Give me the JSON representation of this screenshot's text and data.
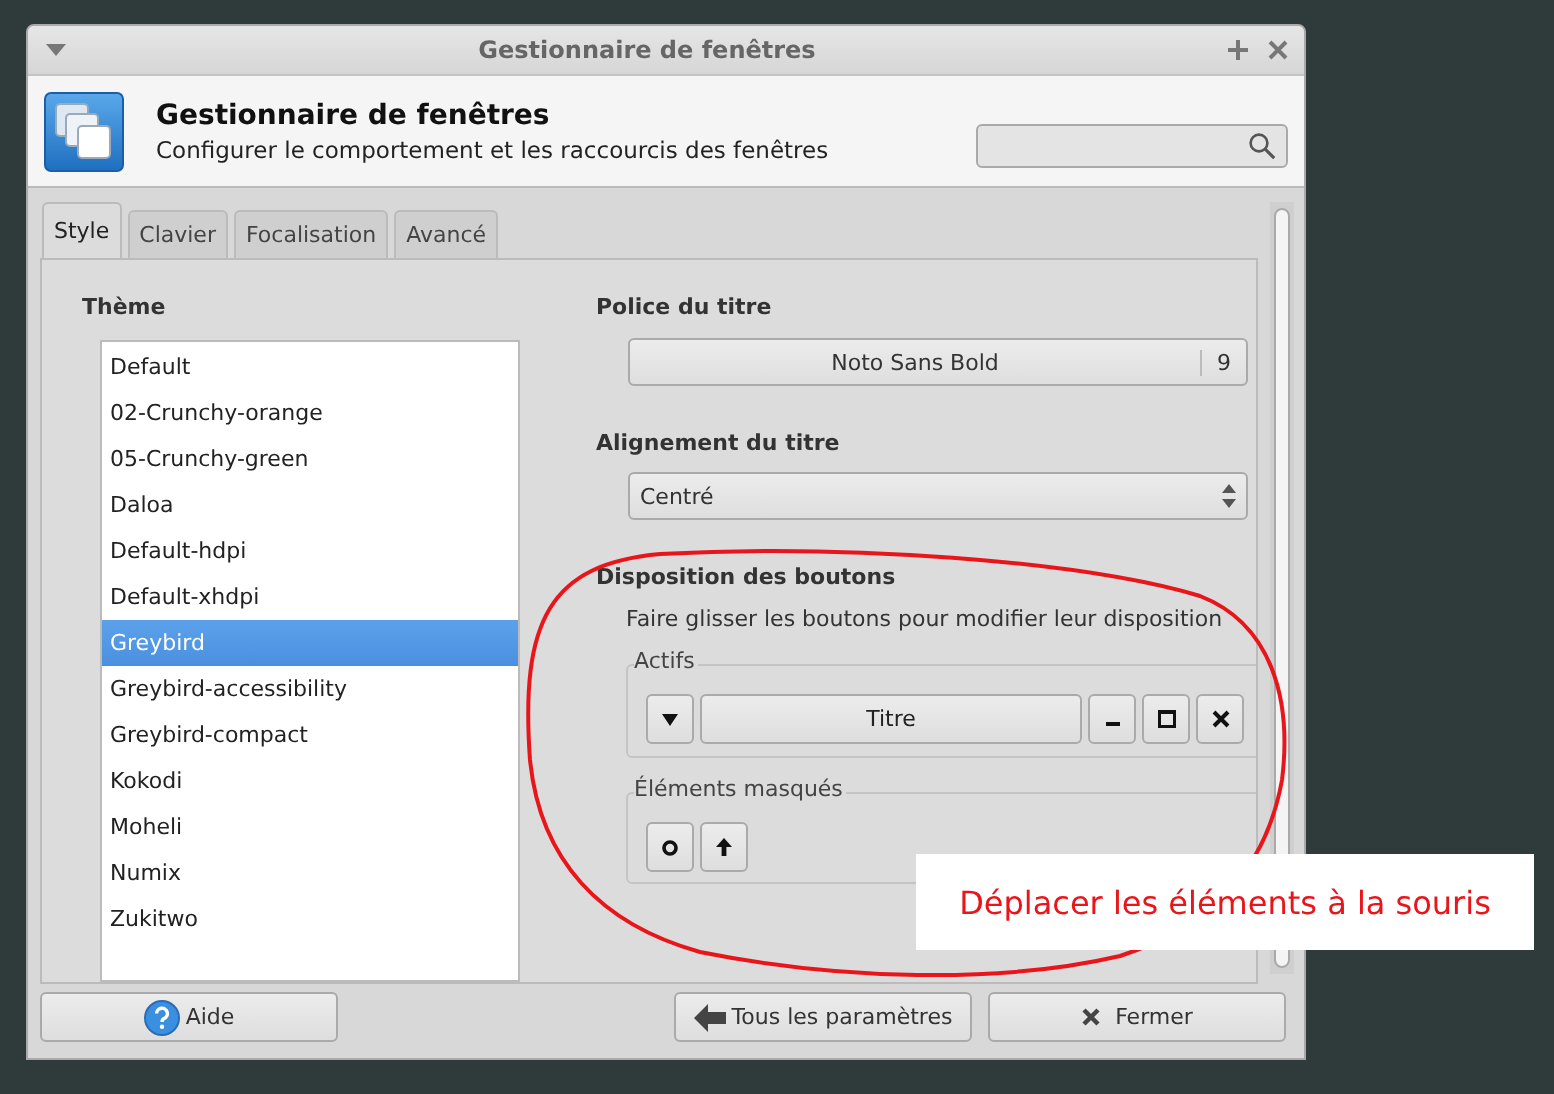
{
  "window": {
    "title": "Gestionnaire de fenêtres"
  },
  "header": {
    "title": "Gestionnaire de fenêtres",
    "subtitle": "Configurer le comportement et les raccourcis des fenêtres"
  },
  "tabs": [
    {
      "label": "Style",
      "selected": true
    },
    {
      "label": "Clavier",
      "selected": false
    },
    {
      "label": "Focalisation",
      "selected": false
    },
    {
      "label": "Avancé",
      "selected": false
    }
  ],
  "theme": {
    "label": "Thème",
    "items": [
      {
        "label": "Default",
        "selected": false
      },
      {
        "label": "02-Crunchy-orange",
        "selected": false
      },
      {
        "label": "05-Crunchy-green",
        "selected": false
      },
      {
        "label": "Daloa",
        "selected": false
      },
      {
        "label": "Default-hdpi",
        "selected": false
      },
      {
        "label": "Default-xhdpi",
        "selected": false
      },
      {
        "label": "Greybird",
        "selected": true
      },
      {
        "label": "Greybird-accessibility",
        "selected": false
      },
      {
        "label": "Greybird-compact",
        "selected": false
      },
      {
        "label": "Kokodi",
        "selected": false
      },
      {
        "label": "Moheli",
        "selected": false
      },
      {
        "label": "Numix",
        "selected": false
      },
      {
        "label": "Zukitwo",
        "selected": false
      }
    ]
  },
  "title_font": {
    "label": "Police du titre",
    "font": "Noto Sans Bold",
    "size": "9"
  },
  "title_alignment": {
    "label": "Alignement du titre",
    "value": "Centré"
  },
  "button_layout": {
    "label": "Disposition des boutons",
    "hint": "Faire glisser les boutons pour modifier leur disposition",
    "active": {
      "label": "Actifs",
      "items": [
        {
          "kind": "menu"
        },
        {
          "kind": "title",
          "label": "Titre"
        },
        {
          "kind": "minimize"
        },
        {
          "kind": "maximize"
        },
        {
          "kind": "close"
        }
      ]
    },
    "hidden": {
      "label": "Éléments masqués",
      "items": [
        {
          "kind": "stick"
        },
        {
          "kind": "shade"
        }
      ]
    }
  },
  "buttons": [
    {
      "kind": "help",
      "label": "Aide"
    },
    {
      "kind": "back",
      "label": "Tous les paramètres"
    },
    {
      "kind": "close",
      "label": "Fermer"
    }
  ],
  "annotation": {
    "text": "Déplacer les éléments à la souris"
  }
}
